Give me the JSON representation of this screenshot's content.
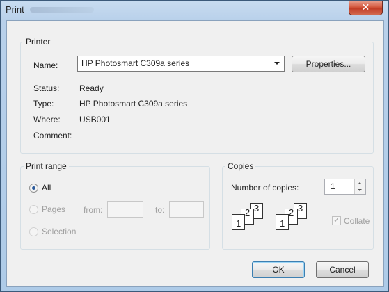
{
  "window": {
    "title": "Print"
  },
  "printer": {
    "group_label": "Printer",
    "name_label": "Name:",
    "selected_printer": "HP Photosmart C309a series",
    "properties_button": "Properties...",
    "status_label": "Status:",
    "status_value": "Ready",
    "type_label": "Type:",
    "type_value": "HP Photosmart C309a series",
    "where_label": "Where:",
    "where_value": "USB001",
    "comment_label": "Comment:"
  },
  "print_range": {
    "group_label": "Print range",
    "all_label": "All",
    "pages_label": "Pages",
    "from_label": "from:",
    "to_label": "to:",
    "selection_label": "Selection",
    "selected_option": "All"
  },
  "copies": {
    "group_label": "Copies",
    "number_label": "Number of copies:",
    "number_value": "1",
    "collate_label": "Collate",
    "collate_checked": true,
    "collate_icon_numbers": [
      "1",
      "2",
      "3"
    ]
  },
  "buttons": {
    "ok": "OK",
    "cancel": "Cancel"
  }
}
